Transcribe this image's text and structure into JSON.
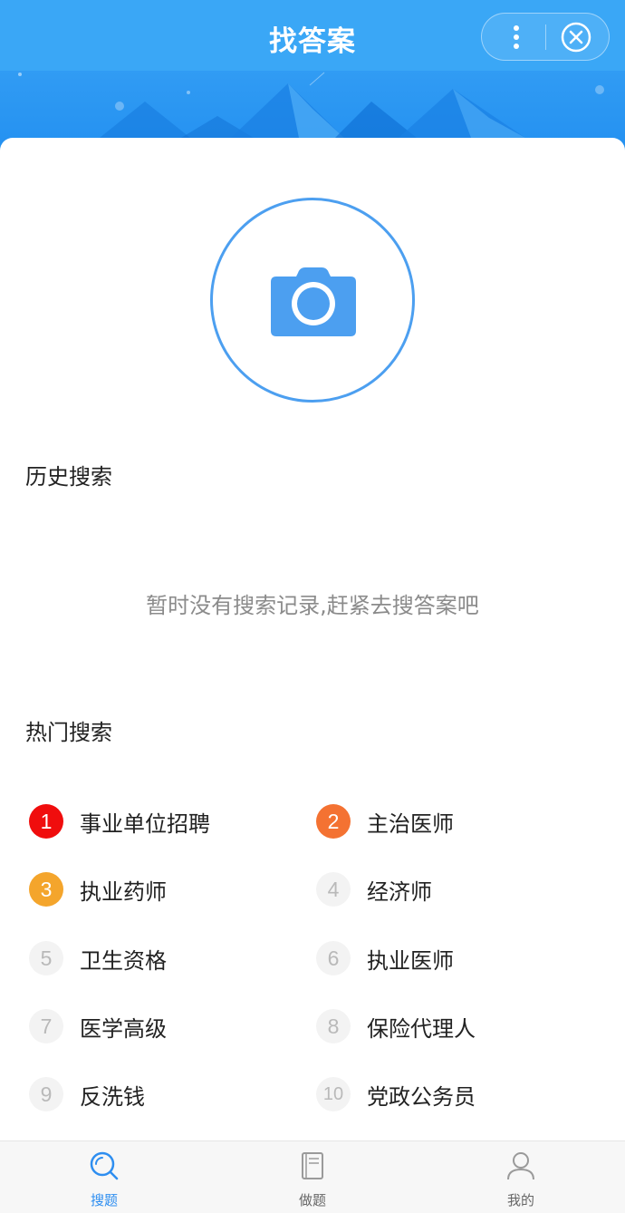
{
  "navbar": {
    "title": "找答案"
  },
  "history": {
    "title": "历史搜索",
    "empty_tip": "暂时没有搜索记录,赶紧去搜答案吧"
  },
  "hot": {
    "title": "热门搜索",
    "items": [
      {
        "rank": "1",
        "label": "事业单位招聘"
      },
      {
        "rank": "2",
        "label": "主治医师"
      },
      {
        "rank": "3",
        "label": "执业药师"
      },
      {
        "rank": "4",
        "label": "经济师"
      },
      {
        "rank": "5",
        "label": "卫生资格"
      },
      {
        "rank": "6",
        "label": "执业医师"
      },
      {
        "rank": "7",
        "label": "医学高级"
      },
      {
        "rank": "8",
        "label": "保险代理人"
      },
      {
        "rank": "9",
        "label": "反洗钱"
      },
      {
        "rank": "10",
        "label": "党政公务员"
      }
    ]
  },
  "tabbar": {
    "tabs": [
      {
        "label": "搜题",
        "icon": "search-icon",
        "active": true
      },
      {
        "label": "做题",
        "icon": "book-icon",
        "active": false
      },
      {
        "label": "我的",
        "icon": "user-icon",
        "active": false
      }
    ]
  },
  "colors": {
    "primary": "#3aa7f6",
    "accent_blue": "#4c9ff0",
    "rank1": "#f00d0d",
    "rank2": "#f47232",
    "rank3": "#f4a52c"
  }
}
